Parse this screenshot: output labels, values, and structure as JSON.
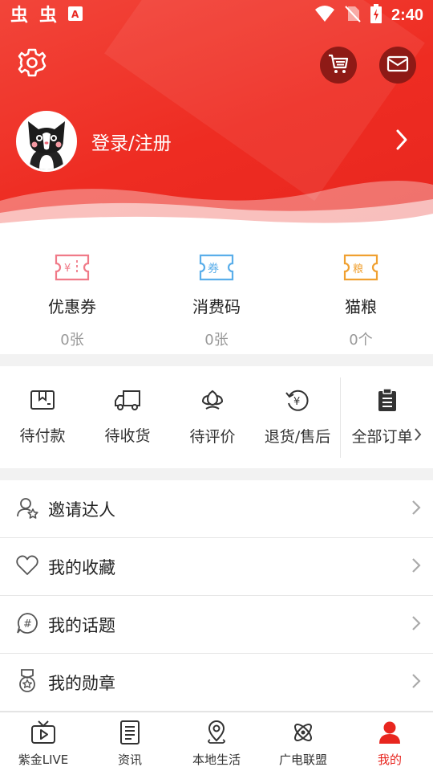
{
  "status_bar": {
    "time": "2:40",
    "left_icons": [
      "app-notification-icon",
      "app-notification-icon",
      "font-app-icon"
    ],
    "right_icons": [
      "wifi-icon",
      "no-sim-icon",
      "battery-charging-icon"
    ]
  },
  "header": {
    "settings_icon": "gear-icon",
    "cart_icon": "cart-icon",
    "message_icon": "mail-icon",
    "login_text": "登录/注册",
    "brand_color": "#e8261f"
  },
  "wallet": {
    "items": [
      {
        "label": "优惠券",
        "count": "0张",
        "icon": "coupon-icon",
        "color": "#f07a88"
      },
      {
        "label": "消费码",
        "count": "0张",
        "icon": "voucher-code-icon",
        "color": "#5aaeea"
      },
      {
        "label": "猫粮",
        "count": "0个",
        "icon": "cat-food-icon",
        "color": "#f0a030"
      }
    ]
  },
  "orders": {
    "items": [
      {
        "label": "待付款",
        "icon": "wallet-icon"
      },
      {
        "label": "待收货",
        "icon": "truck-icon"
      },
      {
        "label": "待评价",
        "icon": "flower-icon"
      },
      {
        "label": "退货/售后",
        "icon": "refund-icon"
      }
    ],
    "all_label": "全部订单"
  },
  "menu": {
    "items": [
      {
        "label": "邀请达人",
        "icon": "invite-user-icon"
      },
      {
        "label": "我的收藏",
        "icon": "heart-icon"
      },
      {
        "label": "我的话题",
        "icon": "topic-hashtag-icon"
      },
      {
        "label": "我的勋章",
        "icon": "medal-icon"
      }
    ]
  },
  "bottom_nav": {
    "items": [
      {
        "label": "紫金LIVE",
        "icon": "tv-icon"
      },
      {
        "label": "资讯",
        "icon": "news-icon"
      },
      {
        "label": "本地生活",
        "icon": "location-icon"
      },
      {
        "label": "广电联盟",
        "icon": "atom-icon"
      },
      {
        "label": "我的",
        "icon": "person-icon",
        "active": true
      }
    ],
    "active_color": "#e8261f"
  }
}
